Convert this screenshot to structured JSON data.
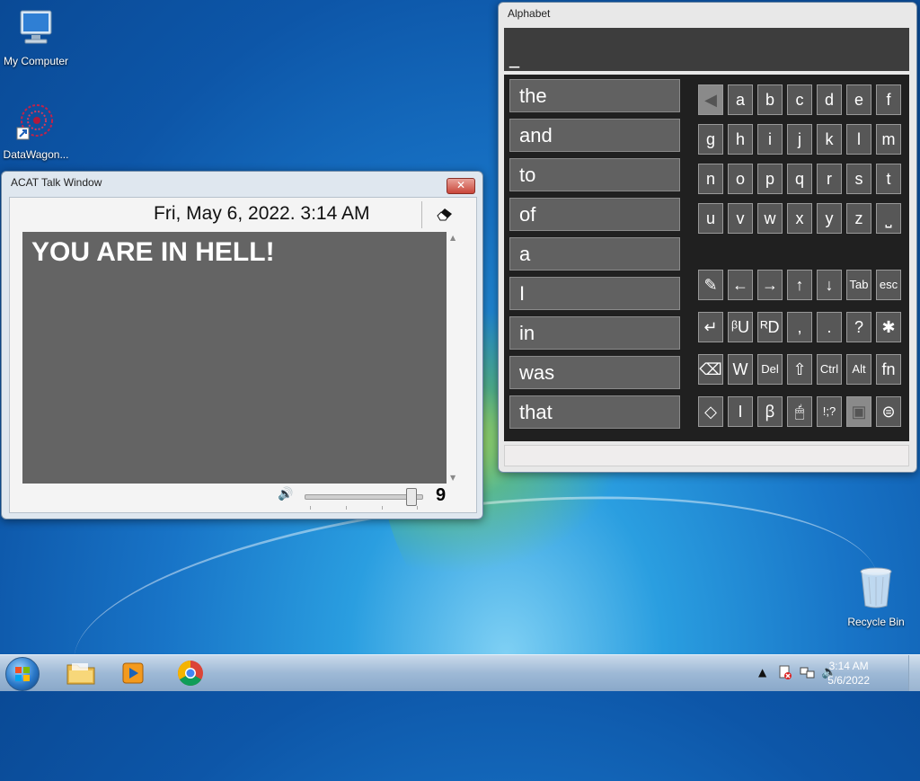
{
  "desktop": {
    "icons": [
      {
        "label": "My Computer"
      },
      {
        "label": "DataWagon..."
      },
      {
        "label": "Recycle Bin"
      }
    ]
  },
  "talk_window": {
    "title": "ACAT Talk Window",
    "close_label": "✕",
    "datetime": "Fri, May 6, 2022. 3:14 AM",
    "eraser_icon": "eraser-icon",
    "text": "YOU ARE IN HELL!",
    "volume_value": "9",
    "volume_level": 0.95
  },
  "alphabet_window": {
    "title": "Alphabet",
    "display_text": "_",
    "words": [
      "the",
      "and",
      "to",
      "of",
      "a",
      "I",
      "in",
      "was",
      "that"
    ],
    "letter_rows": [
      [
        "◀",
        "a",
        "b",
        "c",
        "d",
        "e",
        "f"
      ],
      [
        "g",
        "h",
        "i",
        "j",
        "k",
        "l",
        "m"
      ],
      [
        "n",
        "o",
        "p",
        "q",
        "r",
        "s",
        "t"
      ],
      [
        "u",
        "v",
        "w",
        "x",
        "y",
        "z",
        "⎵"
      ]
    ],
    "function_rows": [
      [
        "✎",
        "←",
        "→",
        "↑",
        "↓",
        "Tab",
        "esc"
      ],
      [
        "↵",
        "ᵝU",
        "ᴿD",
        ",",
        ".",
        "?",
        "✱"
      ],
      [
        "⌫",
        "W",
        "Del",
        "⇧",
        "Ctrl",
        "Alt",
        "fn"
      ],
      [
        "◇",
        "I",
        "ꞵ",
        "🖱",
        "!;?",
        "▣",
        "⊜"
      ]
    ]
  },
  "taskbar": {
    "time": "3:14 AM",
    "date": "5/6/2022"
  }
}
